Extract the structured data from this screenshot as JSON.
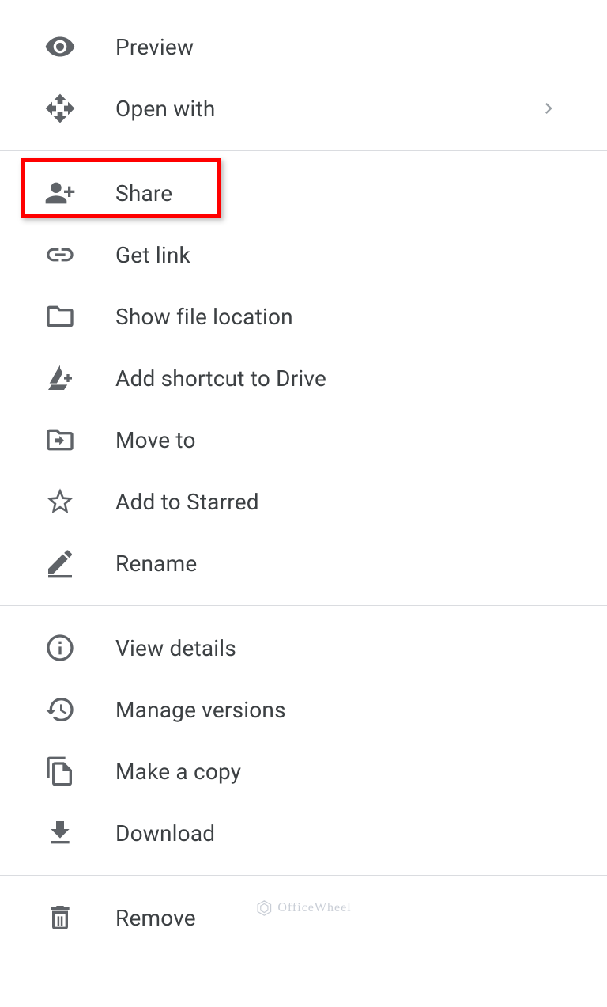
{
  "menu": {
    "groups": [
      [
        {
          "icon": "eye-icon",
          "label": "Preview",
          "submenu": false,
          "highlight": false
        },
        {
          "icon": "move-arrows-icon",
          "label": "Open with",
          "submenu": true,
          "highlight": false
        }
      ],
      [
        {
          "icon": "person-add-icon",
          "label": "Share",
          "submenu": false,
          "highlight": true
        },
        {
          "icon": "link-icon",
          "label": "Get link",
          "submenu": false,
          "highlight": false
        },
        {
          "icon": "folder-icon",
          "label": "Show file location",
          "submenu": false,
          "highlight": false
        },
        {
          "icon": "drive-shortcut-icon",
          "label": "Add shortcut to Drive",
          "submenu": false,
          "highlight": false
        },
        {
          "icon": "folder-move-icon",
          "label": "Move to",
          "submenu": false,
          "highlight": false
        },
        {
          "icon": "star-icon",
          "label": "Add to Starred",
          "submenu": false,
          "highlight": false
        },
        {
          "icon": "pencil-icon",
          "label": "Rename",
          "submenu": false,
          "highlight": false
        }
      ],
      [
        {
          "icon": "info-icon",
          "label": "View details",
          "submenu": false,
          "highlight": false
        },
        {
          "icon": "history-icon",
          "label": "Manage versions",
          "submenu": false,
          "highlight": false
        },
        {
          "icon": "copy-icon",
          "label": "Make a copy",
          "submenu": false,
          "highlight": false
        },
        {
          "icon": "download-icon",
          "label": "Download",
          "submenu": false,
          "highlight": false
        }
      ],
      [
        {
          "icon": "trash-icon",
          "label": "Remove",
          "submenu": false,
          "highlight": false
        }
      ]
    ]
  },
  "watermark": {
    "text": "OfficeWheel"
  }
}
